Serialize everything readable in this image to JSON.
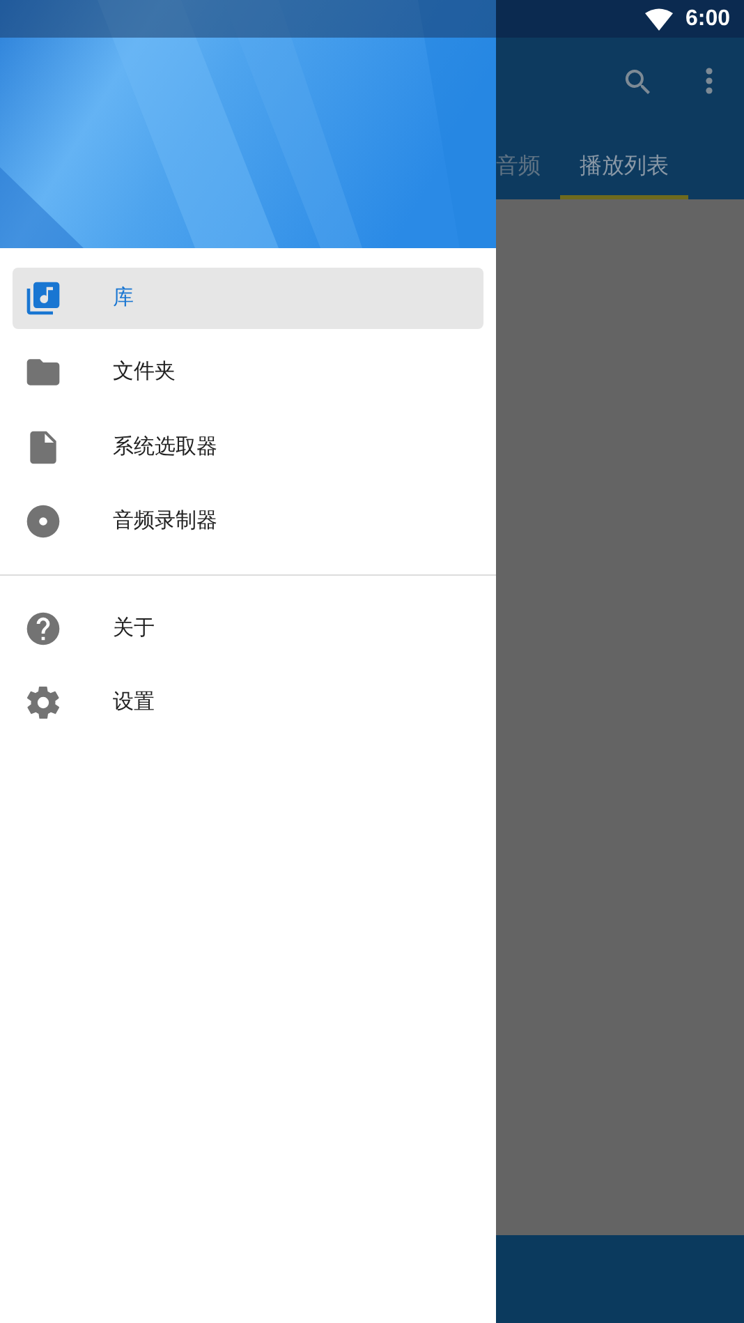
{
  "status_bar": {
    "time": "6:00"
  },
  "app_bar": {
    "tabs": [
      {
        "label": "音频",
        "selected": false
      },
      {
        "label": "播放列表",
        "selected": true
      }
    ]
  },
  "drawer": {
    "sections": [
      [
        {
          "label": "库",
          "selected": true
        },
        {
          "label": "文件夹",
          "selected": false
        },
        {
          "label": "系统选取器",
          "selected": false
        },
        {
          "label": "音频录制器",
          "selected": false
        }
      ],
      [
        {
          "label": "关于",
          "selected": false
        },
        {
          "label": "设置",
          "selected": false
        }
      ]
    ]
  }
}
